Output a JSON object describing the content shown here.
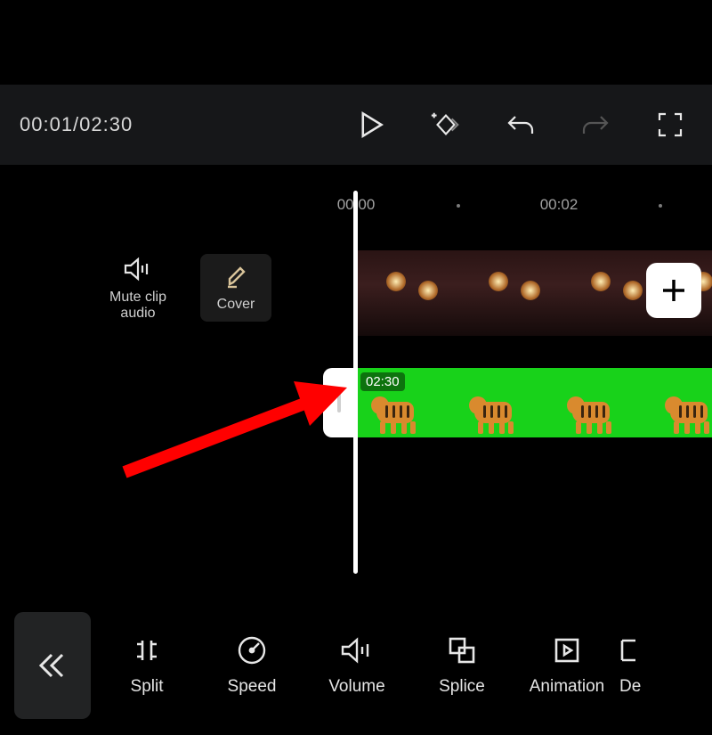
{
  "playback": {
    "current_time": "00:01",
    "total_time": "02:30",
    "display": "00:01/02:30"
  },
  "ruler": {
    "marks": [
      "00:00",
      "00:02"
    ]
  },
  "side_controls": {
    "mute_label_line1": "Mute clip",
    "mute_label_line2": "audio",
    "cover_label": "Cover"
  },
  "overlay_clip": {
    "duration_label": "02:30"
  },
  "toolbar": {
    "items": [
      {
        "id": "split",
        "label": "Split"
      },
      {
        "id": "speed",
        "label": "Speed"
      },
      {
        "id": "volume",
        "label": "Volume"
      },
      {
        "id": "splice",
        "label": "Splice"
      },
      {
        "id": "animation",
        "label": "Animation"
      },
      {
        "id": "delete",
        "label": "De"
      }
    ]
  },
  "icons": {
    "play": "play-icon",
    "keyframe": "add-keyframe-icon",
    "undo": "undo-icon",
    "redo": "redo-icon",
    "fullscreen": "fullscreen-icon",
    "speaker": "speaker-icon",
    "pencil": "pencil-icon",
    "plus": "plus-icon",
    "back": "chevrons-left-icon"
  }
}
